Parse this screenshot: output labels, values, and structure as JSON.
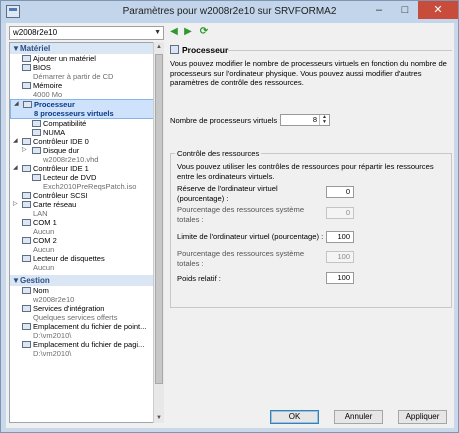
{
  "window": {
    "title": "Paramètres pour w2008r2e10 sur SRVFORMA2"
  },
  "topbar": {
    "vm_selected": "w2008r2e10"
  },
  "sidebar": {
    "hardware_section": "Matériel",
    "hardware_items": [
      {
        "label": "Ajouter un matériel"
      },
      {
        "label": "BIOS",
        "sub": "Démarrer à partir de CD"
      },
      {
        "label": "Mémoire",
        "sub": "4000 Mo"
      },
      {
        "label": "Processeur",
        "sub": "8 processeurs virtuels",
        "selected": true
      },
      {
        "label": "Compatibilité"
      },
      {
        "label": "NUMA"
      },
      {
        "label": "Contrôleur IDE 0"
      },
      {
        "label": "Disque dur",
        "sub": "w2008r2e10.vhd"
      },
      {
        "label": "Contrôleur IDE 1"
      },
      {
        "label": "Lecteur de DVD",
        "sub": "Exch2010PreReqsPatch.iso"
      },
      {
        "label": "Contrôleur SCSI"
      },
      {
        "label": "Carte réseau",
        "sub": "LAN"
      },
      {
        "label": "COM 1",
        "sub": "Aucun"
      },
      {
        "label": "COM 2",
        "sub": "Aucun"
      },
      {
        "label": "Lecteur de disquettes",
        "sub": "Aucun"
      }
    ],
    "management_section": "Gestion",
    "management_items": [
      {
        "label": "Nom",
        "sub": "w2008r2e10"
      },
      {
        "label": "Services d'intégration",
        "sub": "Quelques services offerts"
      },
      {
        "label": "Emplacement du fichier de point...",
        "sub": "D:\\vm2010\\"
      },
      {
        "label": "Emplacement du fichier de pagi...",
        "sub": "D:\\vm2010\\"
      }
    ]
  },
  "panel": {
    "title": "Processeur",
    "description": "Vous pouvez modifier le nombre de processeurs virtuels en fonction du nombre de processeurs sur l'ordinateur physique. Vous pouvez aussi modifier d'autres paramètres de contrôle des ressources.",
    "vcpu_label": "Nombre de processeurs virtuels :",
    "vcpu_value": "8",
    "resource_box": {
      "title": "Contrôle des ressources",
      "intro": "Vous pouvez utiliser les contrôles de ressources pour répartir les ressources entre les ordinateurs virtuels.",
      "reserve_label": "Réserve de l'ordinateur virtuel (pourcentage) :",
      "reserve_value": "0",
      "reserve_total_label": "Pourcentage des ressources système totales :",
      "reserve_total_value": "0",
      "limit_label": "Limite de l'ordinateur virtuel (pourcentage) :",
      "limit_value": "100",
      "limit_total_label": "Pourcentage des ressources système totales :",
      "limit_total_value": "100",
      "weight_label": "Poids relatif :",
      "weight_value": "100"
    }
  },
  "buttons": {
    "ok": "OK",
    "cancel": "Annuler",
    "apply": "Appliquer"
  }
}
